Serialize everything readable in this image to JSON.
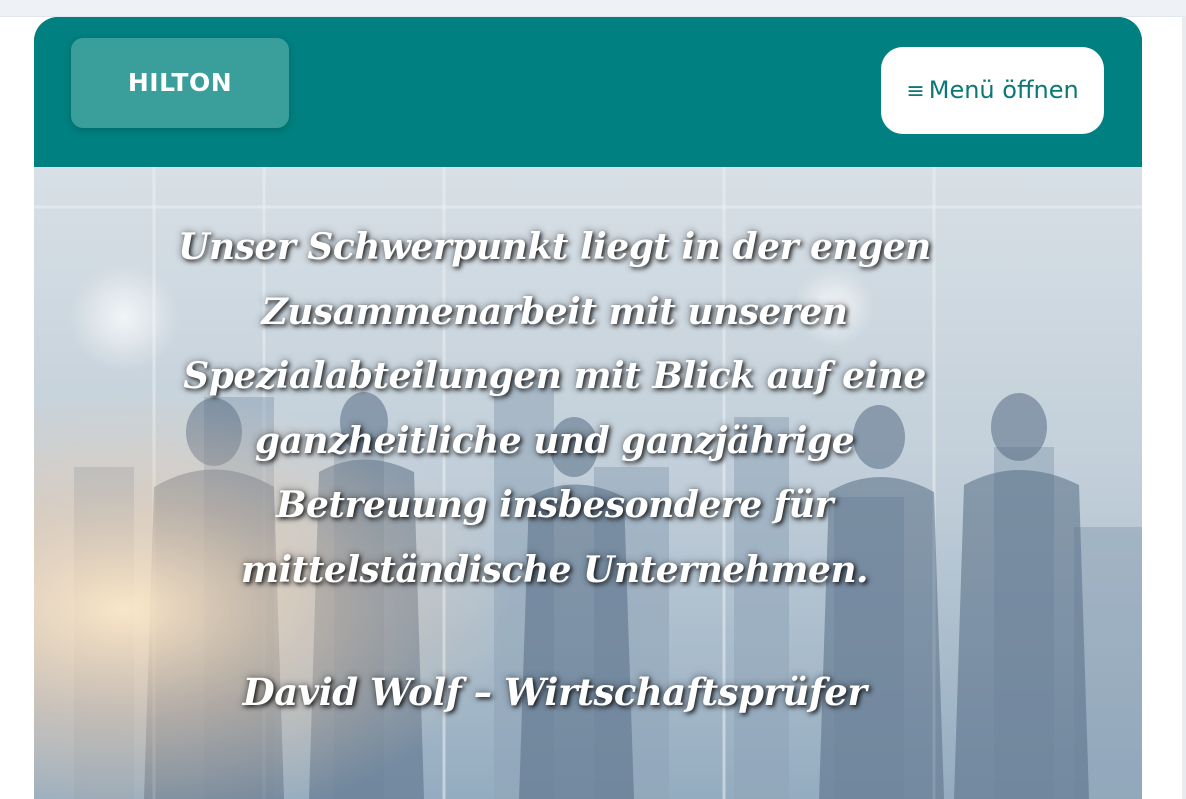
{
  "header": {
    "logo_text": "HILTON",
    "menu_icon": "≡",
    "menu_label": "Menü öffnen"
  },
  "hero": {
    "background_description_icon": "business-people-city-image",
    "quote": "Unser Schwerpunkt liegt in der engen Zusammenarbeit mit unseren Spezialabteilungen mit Blick auf eine ganzheitliche und ganzjährige Betreuung insbesondere für mittelständische Unternehmen.",
    "author": "David Wolf – Wirtschaftsprüfer"
  },
  "colors": {
    "brand_teal": "#008080",
    "logo_teal": "#3a9e9b",
    "menu_text": "#0b7777",
    "text_white": "#ffffff"
  }
}
